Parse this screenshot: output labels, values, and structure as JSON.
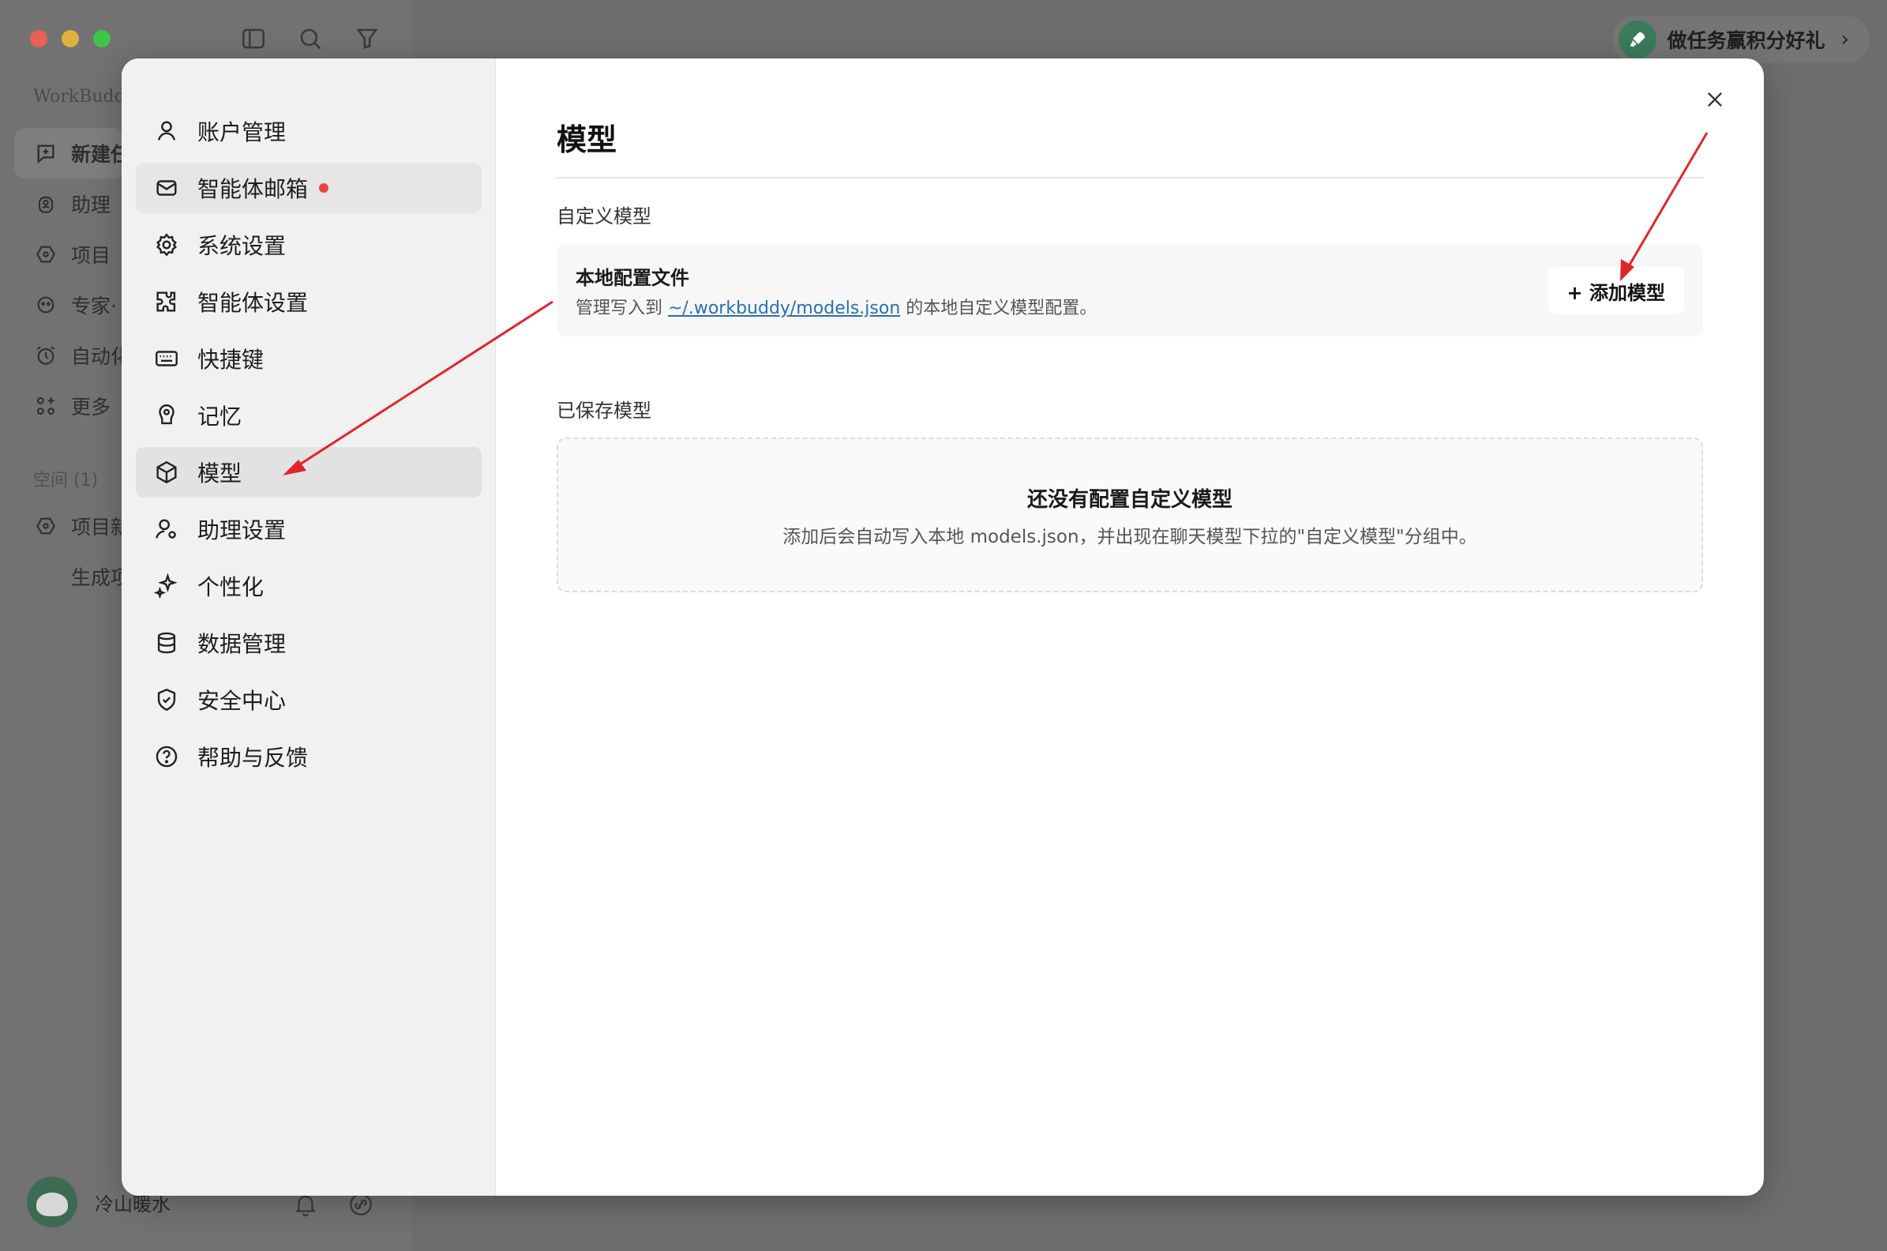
{
  "app": {
    "brand": "WorkBudd",
    "nav": [
      {
        "label": "新建任",
        "icon": "plus-chat-icon",
        "active": true
      },
      {
        "label": "助理",
        "icon": "assistant-icon",
        "active": false
      },
      {
        "label": "项目",
        "icon": "project-icon",
        "active": false
      },
      {
        "label": "专家·",
        "icon": "expert-icon",
        "active": false
      },
      {
        "label": "自动化",
        "icon": "alarm-icon",
        "active": false
      },
      {
        "label": "更多",
        "icon": "apps-icon",
        "active": false
      }
    ],
    "space_label": "空间 (1)",
    "project_item": "项目新",
    "project_sub": "生成项",
    "username": "冷山暖水",
    "promo": "做任务赢积分好礼"
  },
  "settings": {
    "menu": [
      {
        "label": "账户管理",
        "icon": "user-icon"
      },
      {
        "label": "智能体邮箱",
        "icon": "mail-icon",
        "dot": true
      },
      {
        "label": "系统设置",
        "icon": "gear-icon"
      },
      {
        "label": "智能体设置",
        "icon": "puzzle-icon"
      },
      {
        "label": "快捷键",
        "icon": "keyboard-icon"
      },
      {
        "label": "记忆",
        "icon": "memory-icon"
      },
      {
        "label": "模型",
        "icon": "cube-icon",
        "selected": true
      },
      {
        "label": "助理设置",
        "icon": "user-gear-icon"
      },
      {
        "label": "个性化",
        "icon": "sparkle-icon"
      },
      {
        "label": "数据管理",
        "icon": "database-icon"
      },
      {
        "label": "安全中心",
        "icon": "shield-icon"
      },
      {
        "label": "帮助与反馈",
        "icon": "help-icon"
      }
    ],
    "page_title": "模型",
    "custom_section": "自定义模型",
    "config": {
      "title": "本地配置文件",
      "desc_prefix": "管理写入到 ",
      "path": "~/.workbuddy/models.json",
      "desc_suffix": " 的本地自定义模型配置。",
      "add_button": "+ 添加模型"
    },
    "saved_section": "已保存模型",
    "empty": {
      "title": "还没有配置自定义模型",
      "desc": "添加后会自动写入本地 models.json，并出现在聊天模型下拉的\"自定义模型\"分组中。"
    }
  },
  "colors": {
    "accent_link": "#2a6fb0",
    "notification_dot": "#e8443c",
    "annotation_arrow": "#e0262b"
  }
}
